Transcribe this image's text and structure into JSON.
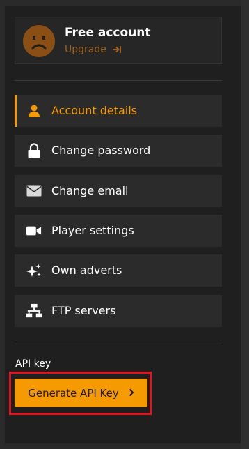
{
  "account": {
    "title": "Free account",
    "upgrade_label": "Upgrade",
    "avatar_icon": "sad-face-icon",
    "upgrade_icon": "arrow-into-bar-icon"
  },
  "menu": {
    "items": [
      {
        "label": "Account details",
        "icon": "user-icon",
        "active": true
      },
      {
        "label": "Change password",
        "icon": "lock-icon",
        "active": false
      },
      {
        "label": "Change email",
        "icon": "envelope-icon",
        "active": false
      },
      {
        "label": "Player settings",
        "icon": "video-camera-icon",
        "active": false
      },
      {
        "label": "Own adverts",
        "icon": "sparkles-icon",
        "active": false
      },
      {
        "label": "FTP servers",
        "icon": "network-icon",
        "active": false
      }
    ]
  },
  "api": {
    "section_label": "API key",
    "button_label": "Generate API Key",
    "button_icon": "chevron-right-icon"
  },
  "colors": {
    "accent": "#f59a00",
    "upgrade_text": "#9c6220",
    "avatar": "#8a4f14",
    "highlight": "#e0141c",
    "background": "#1f1f1f",
    "item_background": "#2b2b2b"
  }
}
